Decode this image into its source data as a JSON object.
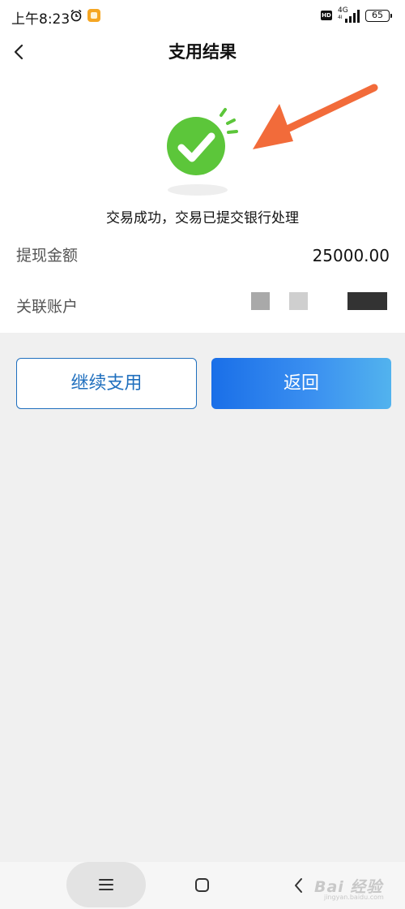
{
  "status_bar": {
    "time": "上午8:23",
    "hd_label": "HD",
    "network": "4G",
    "network_sub": "4I",
    "battery": "65",
    "icons": [
      "alarm-icon",
      "app-notification-icon",
      "signal-icon",
      "battery-icon"
    ]
  },
  "header": {
    "title": "支用结果",
    "back_icon": "chevron-left-icon"
  },
  "result": {
    "icon": "success-check-icon",
    "message": "交易成功，交易已提交银行处理"
  },
  "details": {
    "amount_label": "提现金额",
    "amount_value": "25000.00",
    "account_label": "关联账户"
  },
  "buttons": {
    "continue_label": "继续支用",
    "back_label": "返回"
  },
  "bottom_nav": {
    "menu_icon": "menu-icon",
    "home_icon": "home-icon",
    "back_icon": "back-icon",
    "watermark": "Bai 经验",
    "watermark_sub": "jingyan.baidu.com"
  },
  "colors": {
    "accent_blue": "#1f6fbe",
    "gradient_start": "#1a6fe8",
    "gradient_end": "#52b3ee",
    "success_green": "#5cc63a",
    "annotation_arrow": "#f26b3a"
  }
}
